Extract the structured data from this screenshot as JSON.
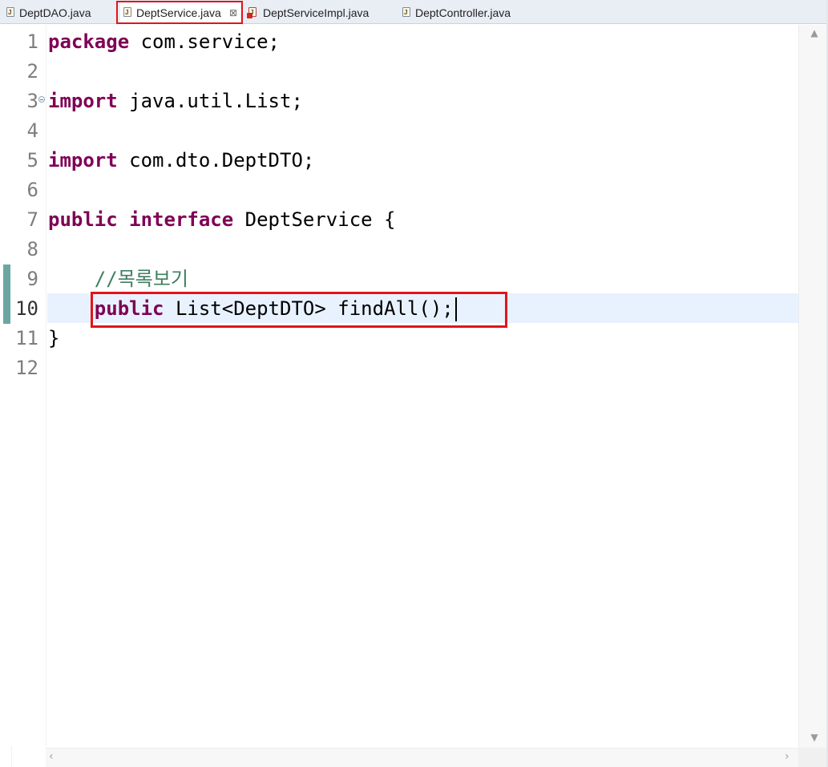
{
  "tabs": [
    {
      "label": "DeptDAO.java",
      "active": false,
      "has_error": false
    },
    {
      "label": "DeptService.java",
      "active": true,
      "has_error": false,
      "close_glyph": "⊠"
    },
    {
      "label": "DeptServiceImpl.java",
      "active": false,
      "has_error": true
    },
    {
      "label": "DeptController.java",
      "active": false,
      "has_error": false
    }
  ],
  "editor": {
    "current_line": 10,
    "changed_lines": [
      9,
      10
    ],
    "line_numbers": [
      "1",
      "2",
      "3",
      "4",
      "5",
      "6",
      "7",
      "8",
      "9",
      "10",
      "11",
      "12"
    ],
    "lines": [
      {
        "no": 1,
        "tokens": [
          {
            "t": "package",
            "k": "kw"
          },
          {
            "t": " com.service;",
            "k": ""
          }
        ]
      },
      {
        "no": 2,
        "tokens": []
      },
      {
        "no": 3,
        "fold": true,
        "tokens": [
          {
            "t": "import",
            "k": "kw"
          },
          {
            "t": " java.util.List;",
            "k": ""
          }
        ]
      },
      {
        "no": 4,
        "tokens": []
      },
      {
        "no": 5,
        "tokens": [
          {
            "t": "import",
            "k": "kw"
          },
          {
            "t": " com.dto.DeptDTO;",
            "k": ""
          }
        ]
      },
      {
        "no": 6,
        "tokens": []
      },
      {
        "no": 7,
        "tokens": [
          {
            "t": "public",
            "k": "kw"
          },
          {
            "t": " ",
            "k": ""
          },
          {
            "t": "interface",
            "k": "kw"
          },
          {
            "t": " DeptService {",
            "k": ""
          }
        ]
      },
      {
        "no": 8,
        "tokens": []
      },
      {
        "no": 9,
        "tokens": [
          {
            "t": "    ",
            "k": ""
          },
          {
            "t": "//목록보기",
            "k": "cm"
          }
        ]
      },
      {
        "no": 10,
        "tokens": [
          {
            "t": "    ",
            "k": ""
          },
          {
            "t": "public",
            "k": "kw"
          },
          {
            "t": " List<DeptDTO> findAll();",
            "k": ""
          }
        ],
        "caret": true
      },
      {
        "no": 11,
        "tokens": [
          {
            "t": "}",
            "k": ""
          }
        ]
      },
      {
        "no": 12,
        "tokens": []
      }
    ]
  },
  "colors": {
    "keyword": "#7f0055",
    "comment": "#3f7f5f",
    "highlight_box": "#e0151a",
    "current_line_bg": "#e8f2fe",
    "change_marker": "#6aa7a2"
  },
  "icons": {
    "java_file": "java-file-icon",
    "java_file_error": "java-file-error-icon",
    "close": "close-icon",
    "fold": "fold-collapse-icon",
    "scroll_up": "scroll-up-icon",
    "scroll_down": "scroll-down-icon",
    "scroll_left": "scroll-left-icon",
    "scroll_right": "scroll-right-icon"
  }
}
